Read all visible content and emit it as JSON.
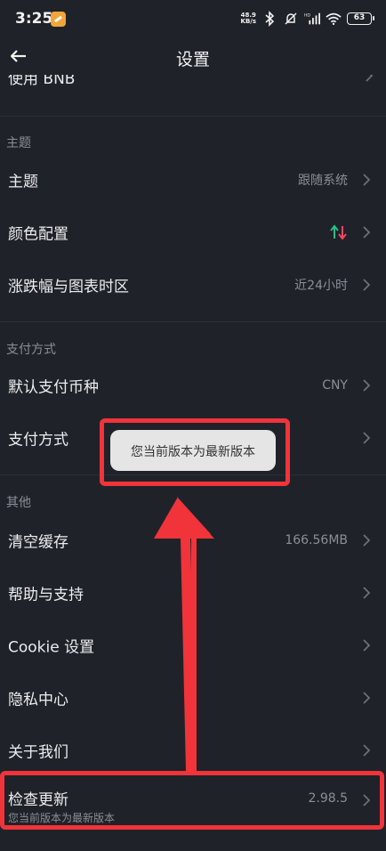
{
  "status_bar": {
    "time": "3:25",
    "net_speed_value": "48.9",
    "net_speed_unit": "KB/s",
    "battery": "63"
  },
  "header": {
    "title": "设置",
    "back_icon": "arrow-left-icon"
  },
  "top_partial_row": {
    "label": "使用 BNB"
  },
  "sections": {
    "theme_section": {
      "title": "主题",
      "rows": [
        {
          "label": "主题",
          "value": "跟随系统"
        },
        {
          "label": "颜色配置",
          "value_icon": "up-down-arrows-icon"
        },
        {
          "label": "涨跌幅与图表时区",
          "value": "近24小时"
        }
      ]
    },
    "payment_section": {
      "title": "支付方式",
      "rows": [
        {
          "label": "默认支付币种",
          "value": "CNY"
        },
        {
          "label": "支付方式"
        }
      ]
    },
    "other_section": {
      "title": "其他",
      "rows": [
        {
          "label": "清空缓存",
          "value": "166.56MB"
        },
        {
          "label": "帮助与支持"
        },
        {
          "label": "Cookie 设置"
        },
        {
          "label": "隐私中心"
        },
        {
          "label": "关于我们"
        }
      ],
      "update_row": {
        "label": "检查更新",
        "sublabel": "您当前版本为最新版本",
        "value": "2.98.5"
      }
    }
  },
  "toast": {
    "text": "您当前版本为最新版本"
  },
  "colors": {
    "background": "#1f2229",
    "up_green": "#2ebd85",
    "down_red": "#f6465d",
    "annotation_red": "#f0343a",
    "toast_bg": "#e5e5e5"
  }
}
